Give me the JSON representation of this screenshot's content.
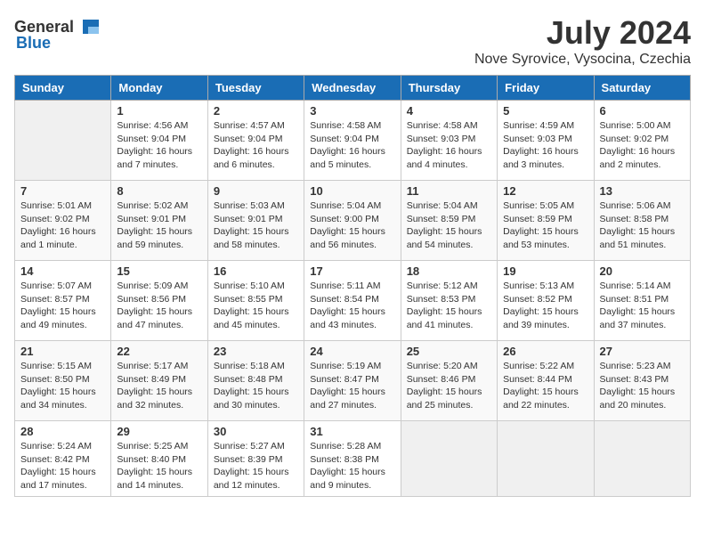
{
  "logo": {
    "text_general": "General",
    "text_blue": "Blue"
  },
  "title": {
    "month": "July 2024",
    "location": "Nove Syrovice, Vysocina, Czechia"
  },
  "days_header": [
    "Sunday",
    "Monday",
    "Tuesday",
    "Wednesday",
    "Thursday",
    "Friday",
    "Saturday"
  ],
  "weeks": [
    [
      {
        "day": "",
        "info": ""
      },
      {
        "day": "1",
        "info": "Sunrise: 4:56 AM\nSunset: 9:04 PM\nDaylight: 16 hours\nand 7 minutes."
      },
      {
        "day": "2",
        "info": "Sunrise: 4:57 AM\nSunset: 9:04 PM\nDaylight: 16 hours\nand 6 minutes."
      },
      {
        "day": "3",
        "info": "Sunrise: 4:58 AM\nSunset: 9:04 PM\nDaylight: 16 hours\nand 5 minutes."
      },
      {
        "day": "4",
        "info": "Sunrise: 4:58 AM\nSunset: 9:03 PM\nDaylight: 16 hours\nand 4 minutes."
      },
      {
        "day": "5",
        "info": "Sunrise: 4:59 AM\nSunset: 9:03 PM\nDaylight: 16 hours\nand 3 minutes."
      },
      {
        "day": "6",
        "info": "Sunrise: 5:00 AM\nSunset: 9:02 PM\nDaylight: 16 hours\nand 2 minutes."
      }
    ],
    [
      {
        "day": "7",
        "info": "Sunrise: 5:01 AM\nSunset: 9:02 PM\nDaylight: 16 hours\nand 1 minute."
      },
      {
        "day": "8",
        "info": "Sunrise: 5:02 AM\nSunset: 9:01 PM\nDaylight: 15 hours\nand 59 minutes."
      },
      {
        "day": "9",
        "info": "Sunrise: 5:03 AM\nSunset: 9:01 PM\nDaylight: 15 hours\nand 58 minutes."
      },
      {
        "day": "10",
        "info": "Sunrise: 5:04 AM\nSunset: 9:00 PM\nDaylight: 15 hours\nand 56 minutes."
      },
      {
        "day": "11",
        "info": "Sunrise: 5:04 AM\nSunset: 8:59 PM\nDaylight: 15 hours\nand 54 minutes."
      },
      {
        "day": "12",
        "info": "Sunrise: 5:05 AM\nSunset: 8:59 PM\nDaylight: 15 hours\nand 53 minutes."
      },
      {
        "day": "13",
        "info": "Sunrise: 5:06 AM\nSunset: 8:58 PM\nDaylight: 15 hours\nand 51 minutes."
      }
    ],
    [
      {
        "day": "14",
        "info": "Sunrise: 5:07 AM\nSunset: 8:57 PM\nDaylight: 15 hours\nand 49 minutes."
      },
      {
        "day": "15",
        "info": "Sunrise: 5:09 AM\nSunset: 8:56 PM\nDaylight: 15 hours\nand 47 minutes."
      },
      {
        "day": "16",
        "info": "Sunrise: 5:10 AM\nSunset: 8:55 PM\nDaylight: 15 hours\nand 45 minutes."
      },
      {
        "day": "17",
        "info": "Sunrise: 5:11 AM\nSunset: 8:54 PM\nDaylight: 15 hours\nand 43 minutes."
      },
      {
        "day": "18",
        "info": "Sunrise: 5:12 AM\nSunset: 8:53 PM\nDaylight: 15 hours\nand 41 minutes."
      },
      {
        "day": "19",
        "info": "Sunrise: 5:13 AM\nSunset: 8:52 PM\nDaylight: 15 hours\nand 39 minutes."
      },
      {
        "day": "20",
        "info": "Sunrise: 5:14 AM\nSunset: 8:51 PM\nDaylight: 15 hours\nand 37 minutes."
      }
    ],
    [
      {
        "day": "21",
        "info": "Sunrise: 5:15 AM\nSunset: 8:50 PM\nDaylight: 15 hours\nand 34 minutes."
      },
      {
        "day": "22",
        "info": "Sunrise: 5:17 AM\nSunset: 8:49 PM\nDaylight: 15 hours\nand 32 minutes."
      },
      {
        "day": "23",
        "info": "Sunrise: 5:18 AM\nSunset: 8:48 PM\nDaylight: 15 hours\nand 30 minutes."
      },
      {
        "day": "24",
        "info": "Sunrise: 5:19 AM\nSunset: 8:47 PM\nDaylight: 15 hours\nand 27 minutes."
      },
      {
        "day": "25",
        "info": "Sunrise: 5:20 AM\nSunset: 8:46 PM\nDaylight: 15 hours\nand 25 minutes."
      },
      {
        "day": "26",
        "info": "Sunrise: 5:22 AM\nSunset: 8:44 PM\nDaylight: 15 hours\nand 22 minutes."
      },
      {
        "day": "27",
        "info": "Sunrise: 5:23 AM\nSunset: 8:43 PM\nDaylight: 15 hours\nand 20 minutes."
      }
    ],
    [
      {
        "day": "28",
        "info": "Sunrise: 5:24 AM\nSunset: 8:42 PM\nDaylight: 15 hours\nand 17 minutes."
      },
      {
        "day": "29",
        "info": "Sunrise: 5:25 AM\nSunset: 8:40 PM\nDaylight: 15 hours\nand 14 minutes."
      },
      {
        "day": "30",
        "info": "Sunrise: 5:27 AM\nSunset: 8:39 PM\nDaylight: 15 hours\nand 12 minutes."
      },
      {
        "day": "31",
        "info": "Sunrise: 5:28 AM\nSunset: 8:38 PM\nDaylight: 15 hours\nand 9 minutes."
      },
      {
        "day": "",
        "info": ""
      },
      {
        "day": "",
        "info": ""
      },
      {
        "day": "",
        "info": ""
      }
    ]
  ]
}
